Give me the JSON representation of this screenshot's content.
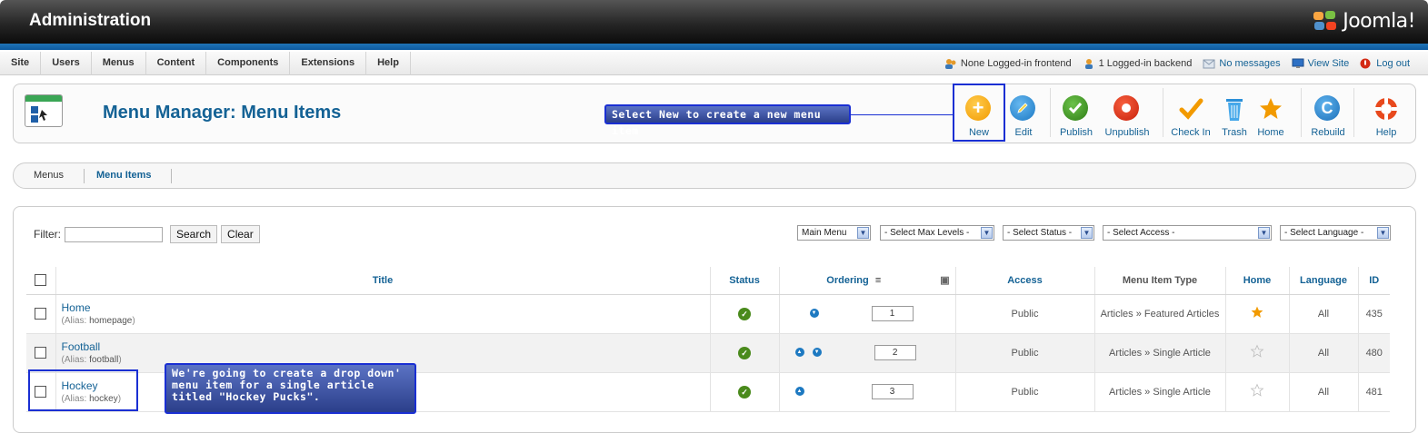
{
  "header": {
    "title": "Administration",
    "brand": "Joomla!"
  },
  "menu": [
    "Site",
    "Users",
    "Menus",
    "Content",
    "Components",
    "Extensions",
    "Help"
  ],
  "status": {
    "frontend": "None Logged-in frontend",
    "backend": "1 Logged-in backend",
    "messages": "No messages",
    "view_site": "View Site",
    "logout": "Log out"
  },
  "toolbar": {
    "page_title": "Menu Manager: Menu Items",
    "new": "New",
    "edit": "Edit",
    "publish": "Publish",
    "unpublish": "Unpublish",
    "checkin": "Check In",
    "trash": "Trash",
    "home": "Home",
    "rebuild": "Rebuild",
    "help": "Help"
  },
  "callouts": {
    "new_hint": "Select New to create a new menu item",
    "hockey_hint": "We're going to create a drop down' menu item for a single article titled \"Hockey Pucks\"."
  },
  "submenu": {
    "menus": "Menus",
    "menu_items": "Menu Items"
  },
  "filter": {
    "label": "Filter:",
    "value": "",
    "search": "Search",
    "clear": "Clear",
    "menu_select": "Main Menu",
    "max_levels": "- Select Max Levels -",
    "status": "- Select Status -",
    "access": "- Select Access -",
    "language": "- Select Language -"
  },
  "table": {
    "headers": {
      "title": "Title",
      "status": "Status",
      "ordering": "Ordering",
      "access": "Access",
      "type": "Menu Item Type",
      "home": "Home",
      "language": "Language",
      "id": "ID"
    },
    "alias_label": "(Alias: ",
    "alias_close": ")",
    "rows": [
      {
        "title": "Home",
        "alias": "homepage",
        "order": "1",
        "access": "Public",
        "type": "Articles » Featured Articles",
        "home": true,
        "language": "All",
        "id": "435"
      },
      {
        "title": "Football",
        "alias": "football",
        "order": "2",
        "access": "Public",
        "type": "Articles » Single Article",
        "home": false,
        "language": "All",
        "id": "480"
      },
      {
        "title": "Hockey",
        "alias": "hockey",
        "order": "3",
        "access": "Public",
        "type": "Articles » Single Article",
        "home": false,
        "language": "All",
        "id": "481"
      }
    ]
  },
  "colors": {
    "link": "#146295",
    "accent_blue": "#1f74b5",
    "callout_border": "#1a2fd3",
    "published": "#4a8a1c"
  }
}
